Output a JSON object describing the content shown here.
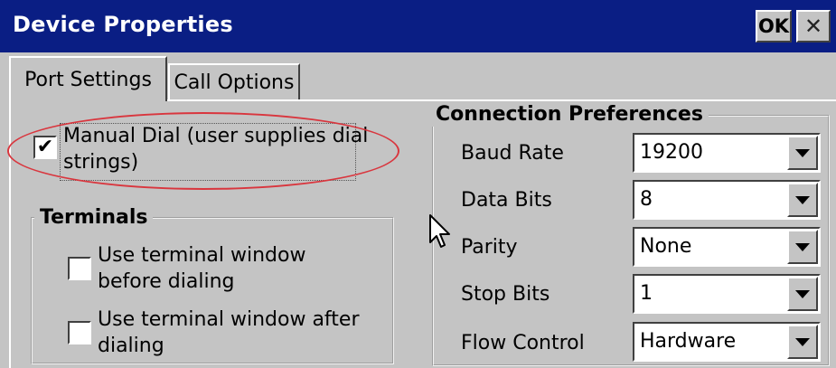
{
  "window": {
    "title": "Device Properties",
    "ok_label": "OK",
    "close_label": "✕"
  },
  "tabs": [
    {
      "label": "Port Settings",
      "selected": true
    },
    {
      "label": "Call Options",
      "selected": false
    }
  ],
  "manual_dial": {
    "checked": true,
    "check_mark": "✔",
    "label_line1": "Manual Dial (user supplies dial",
    "label_line2": "strings)"
  },
  "terminals": {
    "title": "Terminals",
    "before": {
      "line1": "Use terminal window",
      "line2": "before dialing",
      "checked": false
    },
    "after": {
      "line1": "Use terminal window after",
      "line2": "dialing",
      "checked": false
    }
  },
  "connection": {
    "title": "Connection Preferences",
    "baud_rate": {
      "label": "Baud Rate",
      "value": "19200"
    },
    "data_bits": {
      "label": "Data Bits",
      "value": "8"
    },
    "parity": {
      "label": "Parity",
      "value": "None"
    },
    "stop_bits": {
      "label": "Stop Bits",
      "value": "1"
    },
    "flow_control": {
      "label": "Flow Control",
      "value": "Hardware"
    }
  },
  "colors": {
    "titlebar": "#0a1e84",
    "face": "#c4c4c4",
    "highlight_ellipse": "#d9363e"
  }
}
